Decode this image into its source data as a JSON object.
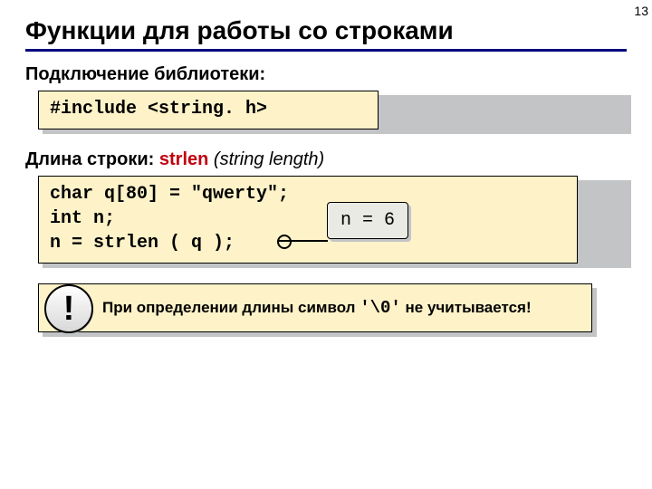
{
  "pageNumber": "13",
  "title": "Функции для работы со строками",
  "section1": {
    "label": "Подключение библиотеки:",
    "code": "#include <string. h>"
  },
  "section2": {
    "labelPrefix": "Длина строки: ",
    "keyword": "strlen",
    "labelSuffixItalic": " (string length)",
    "codeLine1": "char q[80] = \"qwerty\";",
    "codeLine2": "int n;",
    "codeLine3": "n = strlen ( q );",
    "callout": "n = 6"
  },
  "note": {
    "bang": "!",
    "textBefore": "При определении длины символ ",
    "monoPart": "'\\0'",
    "textAfter": " не учитывается!"
  }
}
